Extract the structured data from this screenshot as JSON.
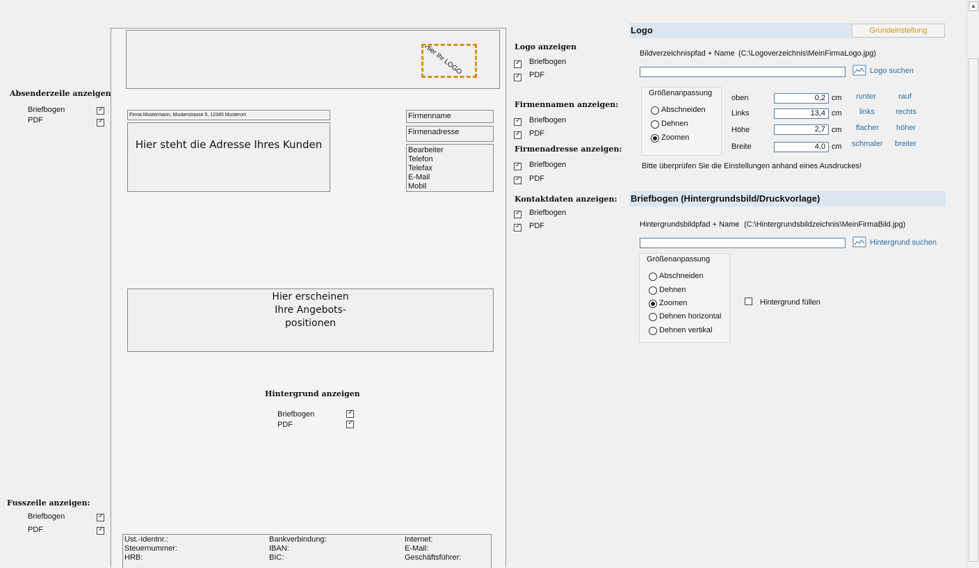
{
  "left": {
    "sender_title": "Absenderzeile anzeigen",
    "sender_options": [
      {
        "label": "Briefbogen",
        "checked": true
      },
      {
        "label": "PDF",
        "checked": true
      }
    ],
    "footer_title": "Fusszeile anzeigen:",
    "footer_options": [
      {
        "label": "Briefbogen",
        "checked": true
      },
      {
        "label": "PDF",
        "checked": true
      }
    ]
  },
  "preview": {
    "logo_text": "Hier Ihr LOGO",
    "sender_line": "Firma Mustermann, Musterstrasse 5, 12345 Musterort",
    "address_text": "Hier steht die Adresse Ihres Kunden",
    "company_name": "Firmenname",
    "company_address": "Firmenadresse",
    "contact_lines": [
      "Bearbeiter",
      "Telefon",
      "Telefax",
      "E-Mail",
      "Mobil"
    ],
    "positions_text": [
      "Hier erscheinen",
      "Ihre Angebots-",
      "positionen"
    ],
    "background_title": "Hintergrund anzeigen",
    "background_options": [
      {
        "label": "Briefbogen",
        "checked": true
      },
      {
        "label": "PDF",
        "checked": true
      }
    ],
    "footer_cols": [
      [
        "Ust.-Identnr.:",
        "Steuernummer:",
        "HRB:"
      ],
      [
        "Bankverbindung:",
        "IBAN:",
        "BIC:"
      ],
      [
        "Internet:",
        "E-Mail:",
        "Geschäftsführer:"
      ]
    ]
  },
  "middle": {
    "logo_title": "Logo anzeigen",
    "logo_options": [
      {
        "label": "Briefbogen",
        "checked": true
      },
      {
        "label": "PDF",
        "checked": true
      }
    ],
    "name_title": "Firmennamen anzeigen:",
    "name_options": [
      {
        "label": "Briefbogen",
        "checked": true
      },
      {
        "label": "PDF",
        "checked": true
      }
    ],
    "address_title": "Firmenadresse anzeigen:",
    "address_options": [
      {
        "label": "Briefbogen",
        "checked": true
      },
      {
        "label": "PDF",
        "checked": true
      }
    ],
    "contact_title": "Kontaktdaten anzeigen:",
    "contact_options": [
      {
        "label": "Briefbogen",
        "checked": true
      },
      {
        "label": "PDF",
        "checked": true
      }
    ]
  },
  "logo_panel": {
    "title": "Logo",
    "default_button": "Grundeinstellung",
    "path_label": "Bildverzeichnispfad + Name",
    "path_value": "(C:\\Logoverzeichnis\\MeinFirmaLogo.jpg)",
    "search_label": "Logo suchen",
    "group_title": "Größenanpassung",
    "radios": [
      {
        "label": "Abschneiden",
        "selected": false
      },
      {
        "label": "Dehnen",
        "selected": false
      },
      {
        "label": "Zoomen",
        "selected": true
      }
    ],
    "dims": [
      {
        "label": "oben",
        "value": "0,2",
        "unit": "cm",
        "link1": "runter",
        "link2": "rauf"
      },
      {
        "label": "Links",
        "value": "13,4",
        "unit": "cm",
        "link1": "links",
        "link2": "rechts"
      },
      {
        "label": "Höhe",
        "value": "2,7",
        "unit": "cm",
        "link1": "flacher",
        "link2": "höher"
      },
      {
        "label": "Breite",
        "value": "4,0",
        "unit": "cm",
        "link1": "schmaler",
        "link2": "breiter"
      }
    ],
    "note": "Bitte überprüfen Sie die Einstellungen anhand eines Ausdruckes!"
  },
  "bg_panel": {
    "title": "Briefbogen (Hintergrundsbild/Druckvorlage)",
    "path_label": "Hintergrundsbildpfad + Name",
    "path_value": "(C:\\Hintergrundsbildzeichnis\\MeinFirmaBild.jpg)",
    "search_label": "Hintergrund suchen",
    "group_title": "Größenanpassung",
    "radios": [
      {
        "label": "Abschneiden",
        "selected": false
      },
      {
        "label": "Dehnen",
        "selected": false
      },
      {
        "label": "Zoomen",
        "selected": true
      },
      {
        "label": "Dehnen horizontal",
        "selected": false
      },
      {
        "label": "Dehnen vertikal",
        "selected": false
      }
    ],
    "fill_label": "Hintergrund füllen",
    "fill_checked": false
  },
  "colors": {
    "accent": "#d4901a",
    "link": "#2e6da0",
    "section": "#dce6f1"
  }
}
